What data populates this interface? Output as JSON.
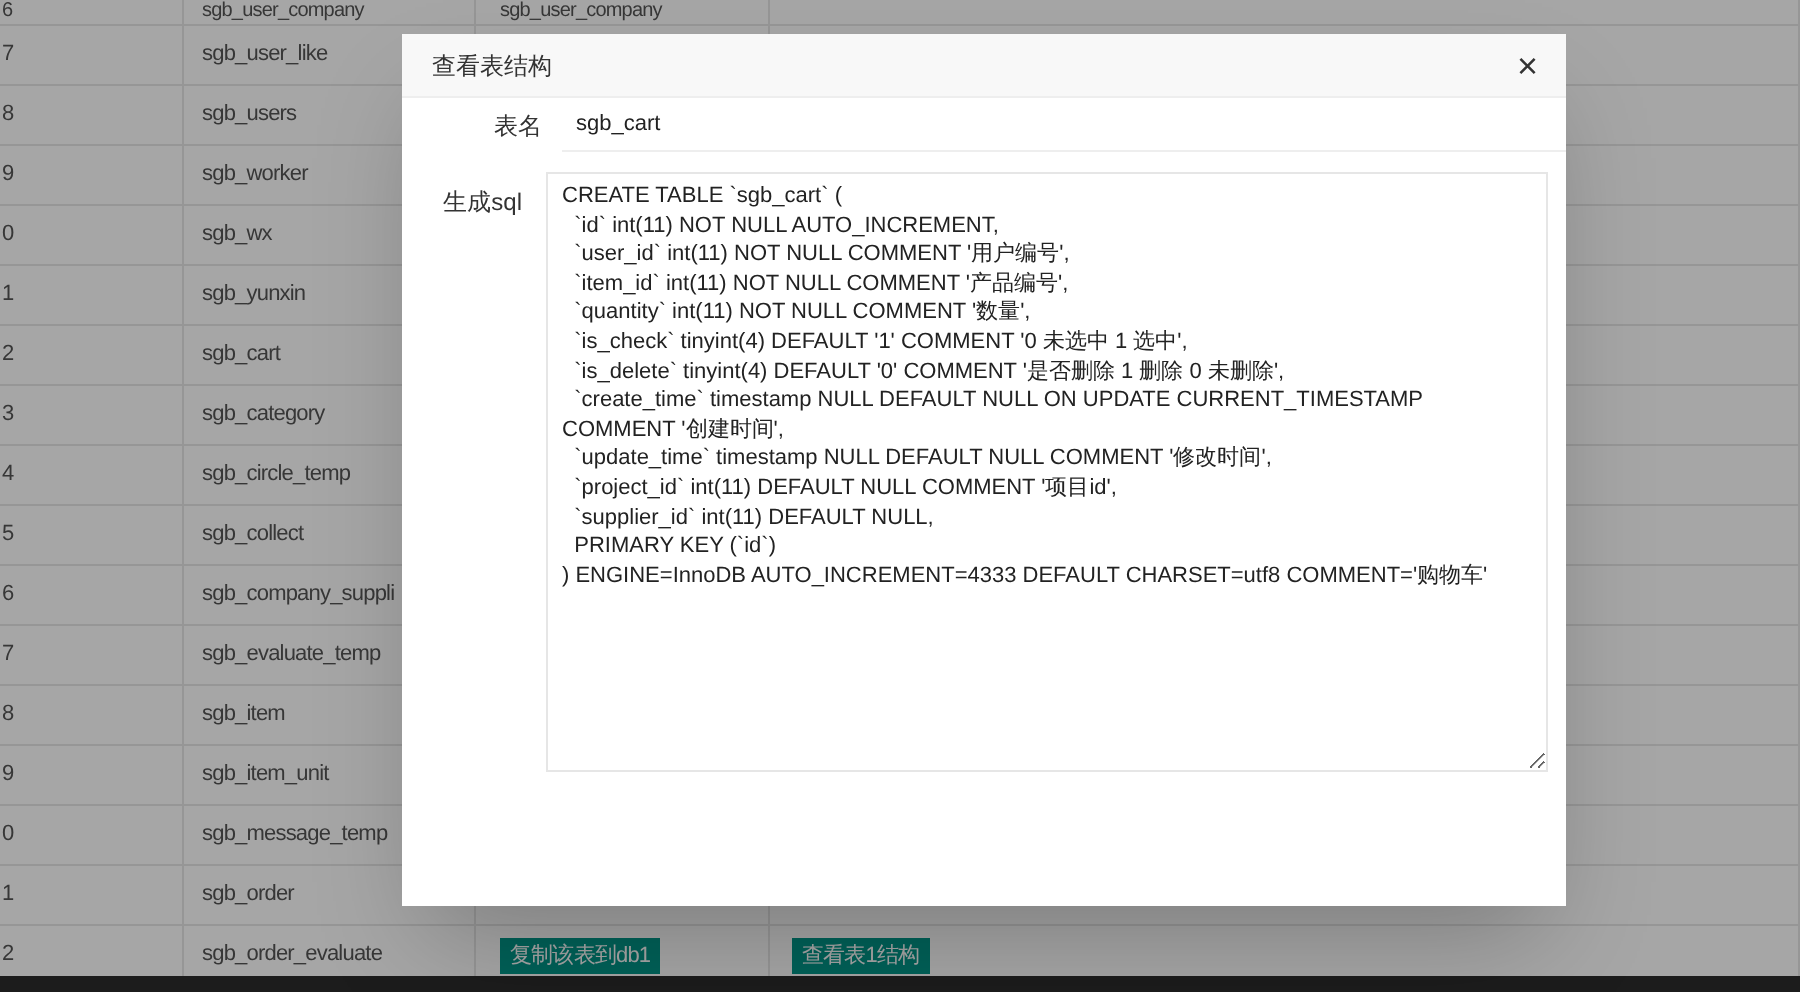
{
  "table": {
    "rows": [
      {
        "index": "6",
        "name": "sgb_user_company",
        "column_3": "sgb_user_company"
      },
      {
        "index": "7",
        "name": "sgb_user_like"
      },
      {
        "index": "8",
        "name": "sgb_users"
      },
      {
        "index": "9",
        "name": "sgb_worker"
      },
      {
        "index": "0",
        "name": "sgb_wx"
      },
      {
        "index": "1",
        "name": "sgb_yunxin"
      },
      {
        "index": "2",
        "name": "sgb_cart"
      },
      {
        "index": "3",
        "name": "sgb_category"
      },
      {
        "index": "4",
        "name": "sgb_circle_temp"
      },
      {
        "index": "5",
        "name": "sgb_collect"
      },
      {
        "index": "6",
        "name": "sgb_company_suppli"
      },
      {
        "index": "7",
        "name": "sgb_evaluate_temp"
      },
      {
        "index": "8",
        "name": "sgb_item"
      },
      {
        "index": "9",
        "name": "sgb_item_unit"
      },
      {
        "index": "0",
        "name": "sgb_message_temp"
      },
      {
        "index": "1",
        "name": "sgb_order"
      },
      {
        "index": "2",
        "name": "sgb_order_evaluate",
        "buttons": [
          "复制该表到db1",
          "查看表1结构"
        ]
      }
    ]
  },
  "dialog": {
    "title": "查看表结构",
    "close": "×",
    "fields": [
      {
        "label": "表名",
        "value": "sgb_cart"
      }
    ],
    "sql_label": "生成sql",
    "sql_lines": [
      "CREATE TABLE `sgb_cart` (",
      "  `id` int(11) NOT NULL AUTO_INCREMENT,",
      "  `user_id` int(11) NOT NULL COMMENT '用户编号',",
      "  `item_id` int(11) NOT NULL COMMENT '产品编号',",
      "  `quantity` int(11) NOT NULL COMMENT '数量',",
      "  `is_check` tinyint(4) DEFAULT '1' COMMENT '0 未选中 1 选中',",
      "  `is_delete` tinyint(4) DEFAULT '0' COMMENT '是否删除 1 删除 0 未删除',",
      "  `create_time` timestamp NULL DEFAULT NULL ON UPDATE CURRENT_TIMESTAMP COMMENT '创建时间',",
      "  `update_time` timestamp NULL DEFAULT NULL COMMENT '修改时间',",
      "  `project_id` int(11) DEFAULT NULL COMMENT '项目id',",
      "  `supplier_id` int(11) DEFAULT NULL,",
      "  PRIMARY KEY (`id`)",
      ") ENGINE=InnoDB AUTO_INCREMENT=4333 DEFAULT CHARSET=utf8 COMMENT='购物车'"
    ]
  }
}
